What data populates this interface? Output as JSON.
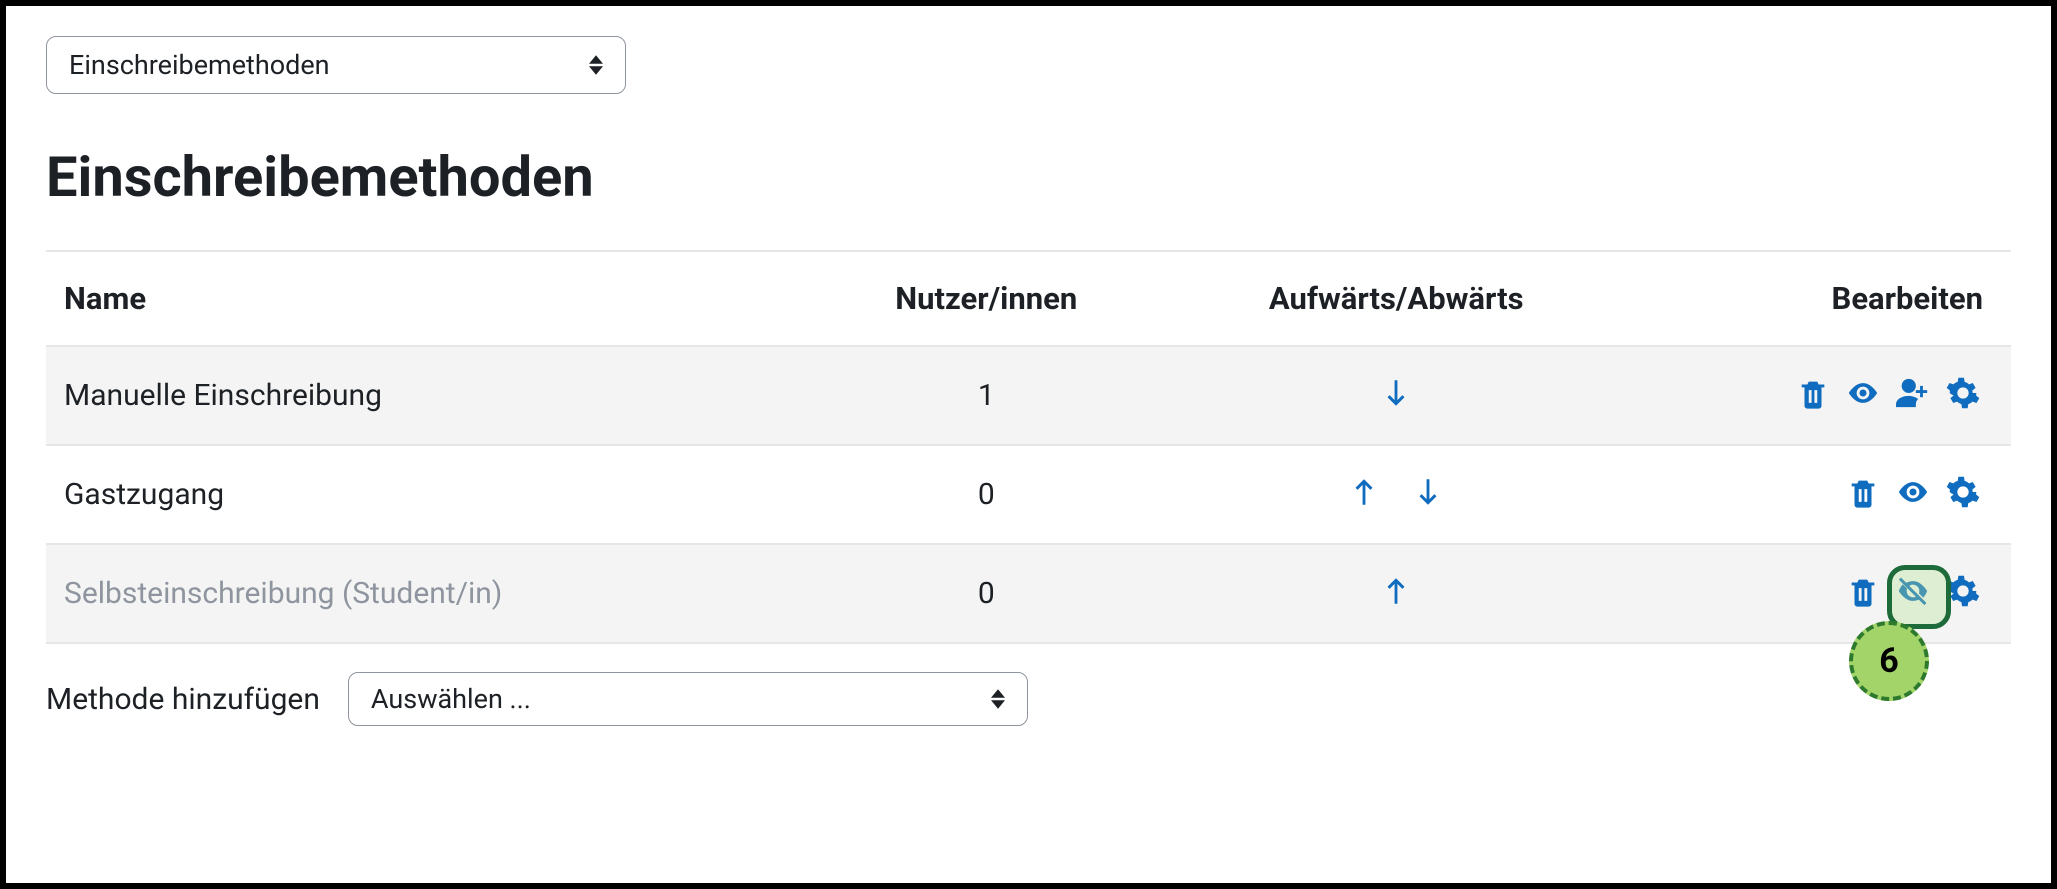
{
  "top_select": {
    "label": "Einschreibemethoden"
  },
  "page_title": "Einschreibemethoden",
  "table": {
    "headers": {
      "name": "Name",
      "users": "Nutzer/innen",
      "updown": "Aufwärts/Abwärts",
      "edit": "Bearbeiten"
    },
    "rows": [
      {
        "name": "Manuelle Einschreibung",
        "users": "1",
        "up": false,
        "down": true,
        "actions": [
          "delete",
          "show",
          "enrol",
          "settings"
        ],
        "alt": true,
        "disabled": false
      },
      {
        "name": "Gastzugang",
        "users": "0",
        "up": true,
        "down": true,
        "actions": [
          "delete",
          "show",
          "settings"
        ],
        "alt": false,
        "disabled": false
      },
      {
        "name": "Selbsteinschreibung (Student/in)",
        "users": "0",
        "up": true,
        "down": false,
        "actions": [
          "delete",
          "hide",
          "settings"
        ],
        "alt": true,
        "disabled": true
      }
    ]
  },
  "add_method": {
    "label": "Methode hinzufügen",
    "placeholder": "Auswählen ..."
  },
  "callout": {
    "number": "6"
  },
  "icon_colors": {
    "primary": "#0f6cbf"
  }
}
